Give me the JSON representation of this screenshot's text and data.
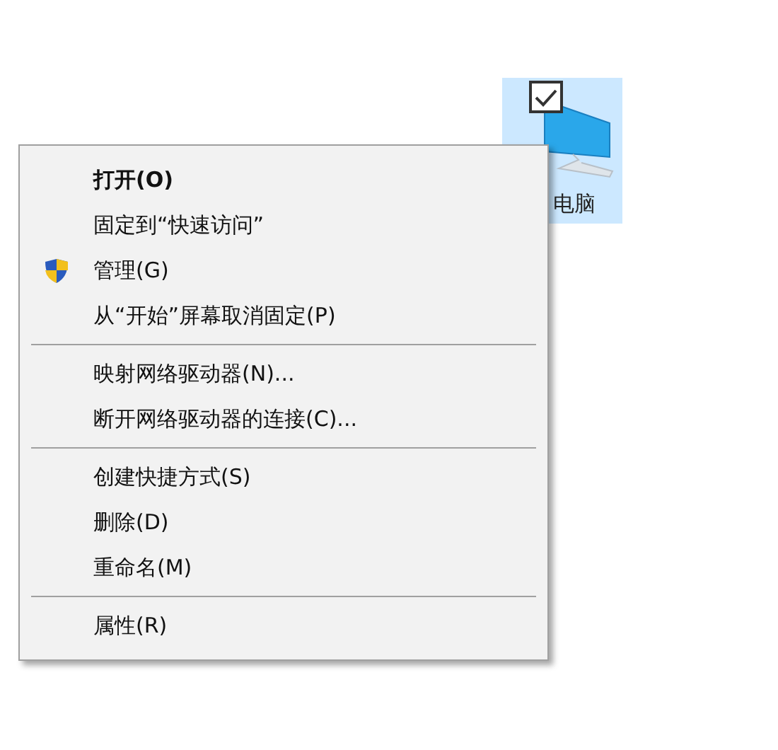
{
  "desktop_icon": {
    "label": "电脑",
    "selected": true,
    "checked": true
  },
  "context_menu": {
    "groups": [
      [
        {
          "label": "打开(O)",
          "default": true,
          "shield": false
        },
        {
          "label": "固定到“快速访问”",
          "default": false,
          "shield": false
        },
        {
          "label": "管理(G)",
          "default": false,
          "shield": true
        },
        {
          "label": "从“开始”屏幕取消固定(P)",
          "default": false,
          "shield": false
        }
      ],
      [
        {
          "label": "映射网络驱动器(N)...",
          "default": false,
          "shield": false
        },
        {
          "label": "断开网络驱动器的连接(C)...",
          "default": false,
          "shield": false
        }
      ],
      [
        {
          "label": "创建快捷方式(S)",
          "default": false,
          "shield": false
        },
        {
          "label": "删除(D)",
          "default": false,
          "shield": false
        },
        {
          "label": "重命名(M)",
          "default": false,
          "shield": false
        }
      ],
      [
        {
          "label": "属性(R)",
          "default": false,
          "shield": false
        }
      ]
    ]
  }
}
